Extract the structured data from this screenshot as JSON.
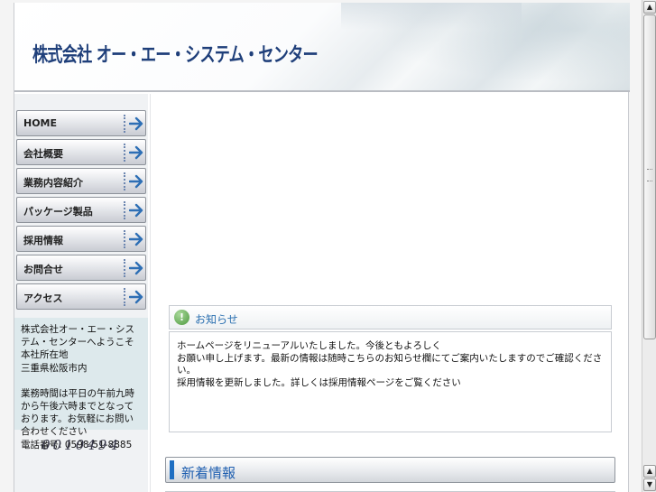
{
  "site": {
    "title": "株式会社 オー・エー・システム・センター"
  },
  "nav": [
    {
      "label": "HOME"
    },
    {
      "label": "会社概要"
    },
    {
      "label": "業務内容紹介"
    },
    {
      "label": "パッケージ製品"
    },
    {
      "label": "採用情報"
    },
    {
      "label": "お問合せ"
    },
    {
      "label": "アクセス"
    }
  ],
  "info": {
    "line1": "株式会社オー・エー・システム・センターへようこそ",
    "line2": "本社所在地",
    "line3": "三重県松阪市内",
    "line4": "業務時間は平日の午前九時から午後六時までとなっております。お気軽にお問い合わせください",
    "line5": "電話番号: 0598-51-8885"
  },
  "counter": {
    "value": "0010494"
  },
  "notice": {
    "title": "お知らせ",
    "lines": [
      "ホームページをリニューアルいたしました。今後ともよろしく",
      "お願い申し上げます。最新の情報は随時こちらのお知らせ欄にてご案内いたしますのでご確認ください。",
      "採用情報を更新しました。詳しくは採用情報ページをご覧ください"
    ]
  },
  "section": {
    "title": "新着情報"
  },
  "colors": {
    "accent": "#1f6fc2",
    "title": "#1f3f7a",
    "info_bg": "#dde9ec"
  },
  "icons": {
    "notice": "exclamation-circle-icon",
    "nav_arrow": "arrow-right-icon"
  }
}
